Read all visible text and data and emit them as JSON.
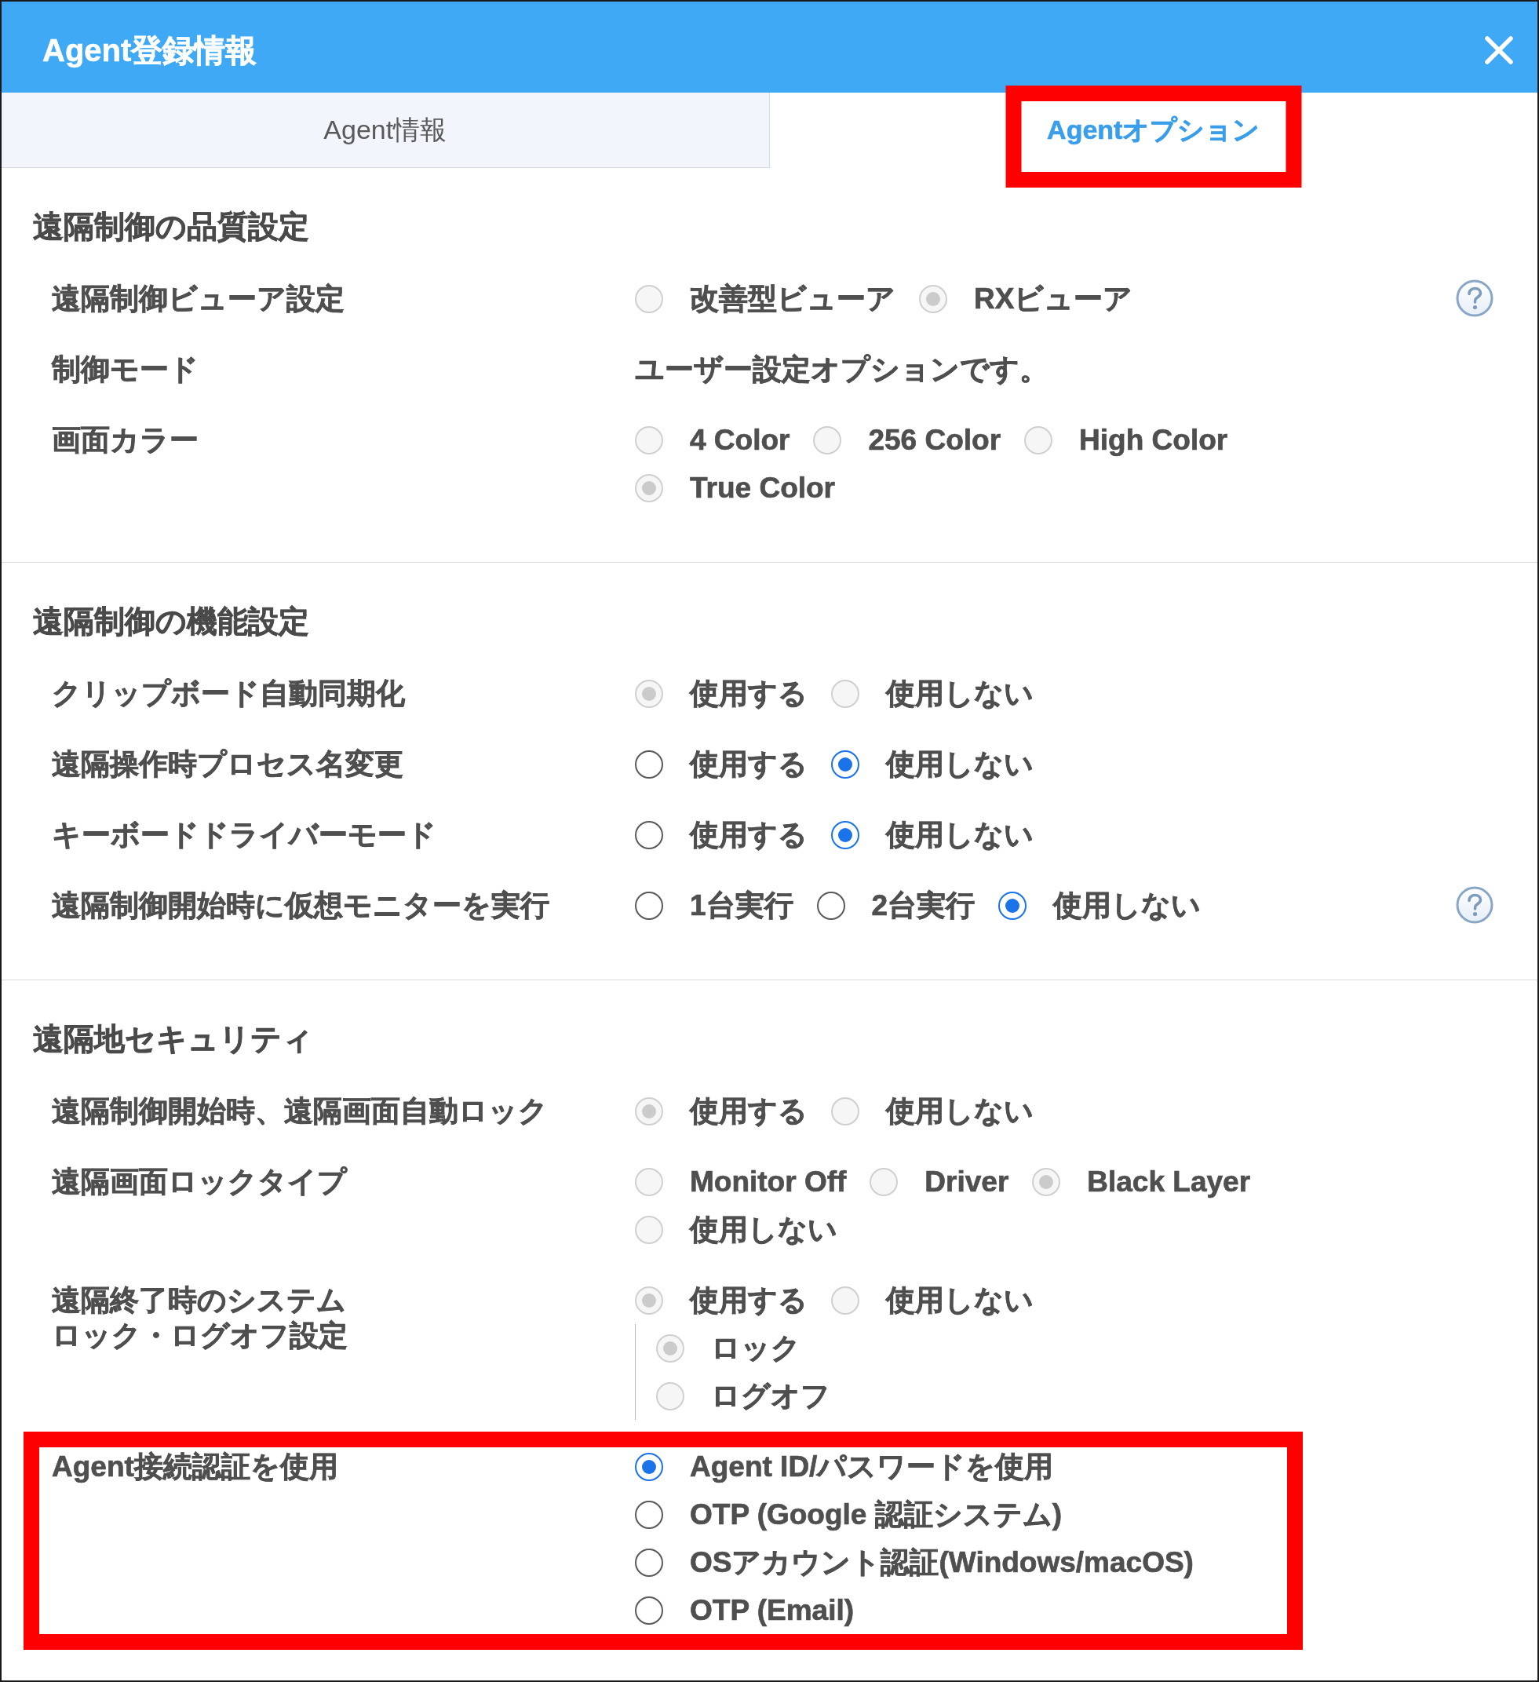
{
  "dialog": {
    "title": "Agent登録情報"
  },
  "tabs": [
    {
      "label": "Agent情報",
      "selected": false,
      "highlighted": false
    },
    {
      "label": "Agentオプション",
      "selected": true,
      "highlighted": true
    }
  ],
  "sections": [
    {
      "title": "遠隔制御の品質設定",
      "rows": [
        {
          "kind": "radio",
          "label": "遠隔制御ビューア設定",
          "disabled": true,
          "help": true,
          "highlighted": false,
          "options": [
            {
              "label": "改善型ビューア",
              "selected": false
            },
            {
              "label": "RXビューア",
              "selected": true
            }
          ]
        },
        {
          "kind": "text",
          "label": "制御モード",
          "value": "ユーザー設定オプションです。",
          "help": false,
          "highlighted": false
        },
        {
          "kind": "radio",
          "label": "画面カラー",
          "disabled": true,
          "help": false,
          "highlighted": false,
          "options": [
            {
              "label": "4 Color",
              "selected": false
            },
            {
              "label": "256 Color",
              "selected": false
            },
            {
              "label": "High Color",
              "selected": false
            },
            {
              "label": "True Color",
              "selected": true
            }
          ]
        }
      ]
    },
    {
      "title": "遠隔制御の機能設定",
      "rows": [
        {
          "kind": "radio",
          "label": "クリップボード自動同期化",
          "disabled": true,
          "help": false,
          "highlighted": false,
          "options": [
            {
              "label": "使用する",
              "selected": true
            },
            {
              "label": "使用しない",
              "selected": false
            }
          ]
        },
        {
          "kind": "radio",
          "label": "遠隔操作時プロセス名変更",
          "disabled": false,
          "help": false,
          "highlighted": false,
          "options": [
            {
              "label": "使用する",
              "selected": false
            },
            {
              "label": "使用しない",
              "selected": true
            }
          ]
        },
        {
          "kind": "radio",
          "label": "キーボードドライバーモード",
          "disabled": false,
          "help": false,
          "highlighted": false,
          "options": [
            {
              "label": "使用する",
              "selected": false
            },
            {
              "label": "使用しない",
              "selected": true
            }
          ]
        },
        {
          "kind": "radio",
          "label": "遠隔制御開始時に仮想モニターを実行",
          "disabled": false,
          "help": true,
          "highlighted": false,
          "options": [
            {
              "label": "1台実行",
              "selected": false
            },
            {
              "label": "2台実行",
              "selected": false
            },
            {
              "label": "使用しない",
              "selected": true
            }
          ]
        }
      ]
    },
    {
      "title": "遠隔地セキュリティ",
      "rows": [
        {
          "kind": "radio",
          "label": "遠隔制御開始時、遠隔画面自動ロック",
          "disabled": true,
          "help": false,
          "highlighted": false,
          "options": [
            {
              "label": "使用する",
              "selected": true
            },
            {
              "label": "使用しない",
              "selected": false
            }
          ]
        },
        {
          "kind": "radio",
          "label": "遠隔画面ロックタイプ",
          "disabled": true,
          "help": false,
          "highlighted": false,
          "options": [
            {
              "label": "Monitor Off",
              "selected": false
            },
            {
              "label": "Driver",
              "selected": false
            },
            {
              "label": "Black Layer",
              "selected": true
            },
            {
              "label": "使用しない",
              "selected": false
            }
          ]
        },
        {
          "kind": "radio",
          "label_lines": [
            "遠隔終了時のシステム",
            "ロック・ログオフ設定"
          ],
          "disabled": true,
          "help": false,
          "highlighted": false,
          "options": [
            {
              "label": "使用する",
              "selected": true
            },
            {
              "label": "使用しない",
              "selected": false
            }
          ],
          "sub_options": [
            {
              "label": "ロック",
              "selected": true
            },
            {
              "label": "ログオフ",
              "selected": false
            }
          ]
        },
        {
          "kind": "radio-list",
          "label": "Agent接続認証を使用",
          "disabled": false,
          "help": false,
          "highlighted": true,
          "options": [
            {
              "label": "Agent ID/パスワードを使用",
              "selected": true
            },
            {
              "label": "OTP (Google 認証システム)",
              "selected": false
            },
            {
              "label": "OSアカウント認証(Windows/macOS)",
              "selected": false
            },
            {
              "label": "OTP (Email)",
              "selected": false
            }
          ]
        }
      ]
    }
  ]
}
